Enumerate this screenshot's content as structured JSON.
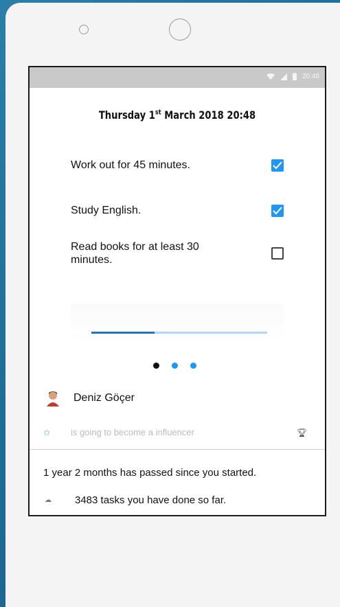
{
  "status_bar": {
    "time": "20:48"
  },
  "date": {
    "day": "Thursday 1",
    "suffix": "st",
    "rest": " March 2018 20:48"
  },
  "tasks": [
    {
      "label": "Work out for 45 minutes.",
      "checked": true
    },
    {
      "label": "Study English.",
      "checked": true
    },
    {
      "label": "Read books for at least 30 minutes.",
      "checked": false
    }
  ],
  "progress": 0.36,
  "pager": {
    "active_index": 0,
    "count": 3
  },
  "profile": {
    "name": "Deniz Göçer",
    "status": "is going to become a influencer"
  },
  "stats": {
    "since": "1 year 2 months has passed since you started.",
    "tasks_done": "3483 tasks you have done so far."
  },
  "colors": {
    "accent": "#2196f3",
    "progress_fill": "#2176c4",
    "progress_track": "#b3d7f5",
    "status_bar": "#c9c9c9"
  },
  "icons": {
    "earpiece": "earpiece-icon",
    "camera": "front-camera-icon",
    "star": "star-icon",
    "trophy": "trophy-icon",
    "cloud": "cloud-icon"
  }
}
